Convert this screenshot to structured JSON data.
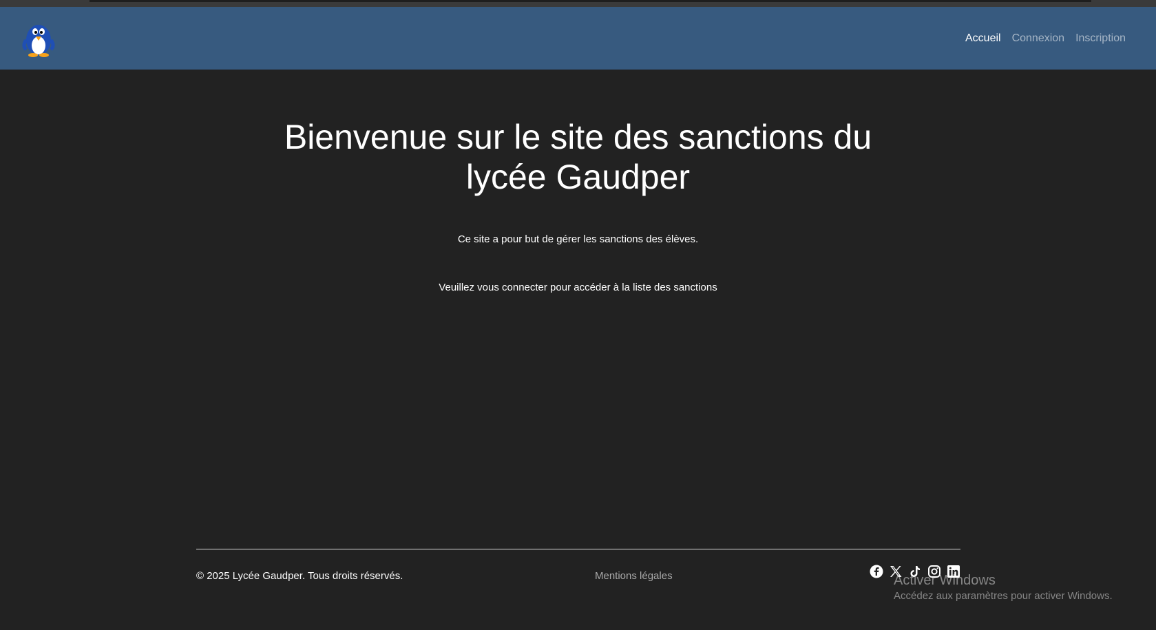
{
  "nav": {
    "logo": "penguin-logo",
    "links": [
      {
        "label": "Accueil",
        "active": true
      },
      {
        "label": "Connexion",
        "active": false
      },
      {
        "label": "Inscription",
        "active": false
      }
    ]
  },
  "hero": {
    "title": "Bienvenue sur le site des sanctions du lycée Gaudper",
    "line1": "Ce site a pour but de gérer les sanctions des élèves.",
    "line2": "Veuillez vous connecter pour accéder à la liste des sanctions"
  },
  "footer": {
    "copyright": "© 2025 Lycée Gaudper. Tous droits réservés.",
    "legal": "Mentions légales",
    "socials": [
      "facebook-icon",
      "x-icon",
      "tiktok-icon",
      "instagram-icon",
      "linkedin-icon"
    ]
  },
  "overlay": {
    "title": "Activer Windows",
    "subtitle": "Accédez aux paramètres pour activer Windows."
  },
  "colors": {
    "navbar": "#375a7f",
    "background": "#222222"
  }
}
